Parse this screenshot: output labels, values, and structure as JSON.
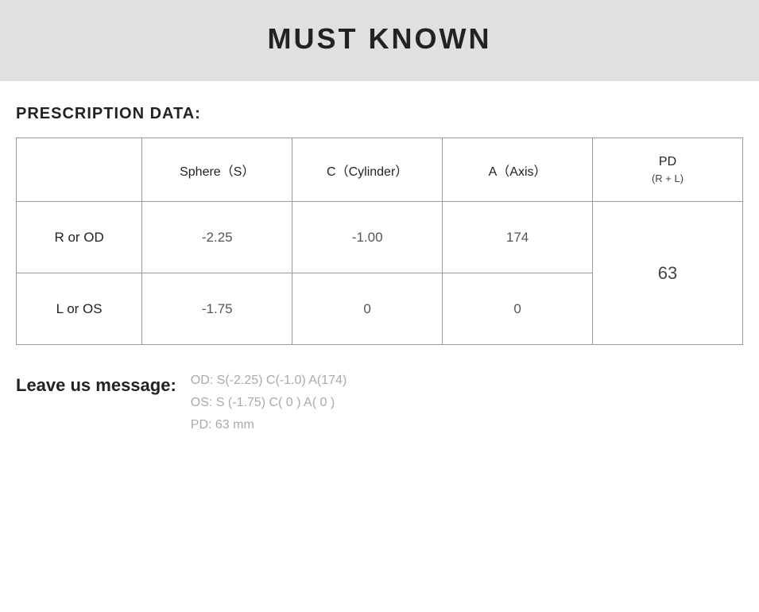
{
  "header": {
    "title": "MUST KNOWN"
  },
  "section": {
    "label": "PRESCRIPTION DATA:"
  },
  "table": {
    "columns": [
      {
        "id": "label",
        "header": ""
      },
      {
        "id": "sphere",
        "header": "Sphere（S）"
      },
      {
        "id": "cylinder",
        "header": "C（Cylinder）"
      },
      {
        "id": "axis",
        "header": "A（Axis）"
      },
      {
        "id": "pd",
        "header": "PD",
        "sub": "(R + L)"
      }
    ],
    "rows": [
      {
        "label": "R or OD",
        "sphere": "-2.25",
        "cylinder": "-1.00",
        "axis": "174"
      },
      {
        "label": "L or OS",
        "sphere": "-1.75",
        "cylinder": "0",
        "axis": "0"
      }
    ],
    "pd_value": "63"
  },
  "leave_message": {
    "label": "Leave us message:",
    "lines": [
      "OD:  S(-2.25)    C(-1.0)   A(174)",
      "OS:  S (-1.75)   C( 0 )    A( 0 )",
      "PD:  63 mm"
    ]
  }
}
